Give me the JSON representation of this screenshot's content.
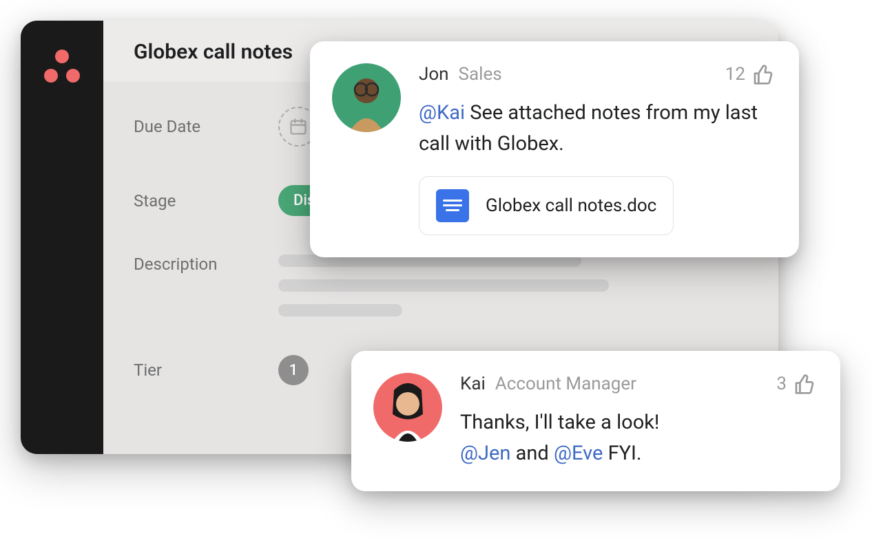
{
  "task": {
    "title": "Globex call notes",
    "fields": {
      "due_date_label": "Due Date",
      "stage_label": "Stage",
      "stage_value": "Dis",
      "description_label": "Description",
      "tier_label": "Tier",
      "tier_value": "1"
    }
  },
  "comments": [
    {
      "author_name": "Jon",
      "author_role": "Sales",
      "like_count": "12",
      "text_parts": {
        "mention": "@Kai",
        "body": " See attached notes from my last call with Globex."
      },
      "attachment_name": "Globex call notes.doc"
    },
    {
      "author_name": "Kai",
      "author_role": "Account Manager",
      "like_count": "3",
      "text_parts": {
        "prefix": "Thanks, I'll take a look! ",
        "mention1": "@Jen",
        "mid": " and ",
        "mention2": "@Eve",
        "suffix": " FYI."
      }
    }
  ]
}
